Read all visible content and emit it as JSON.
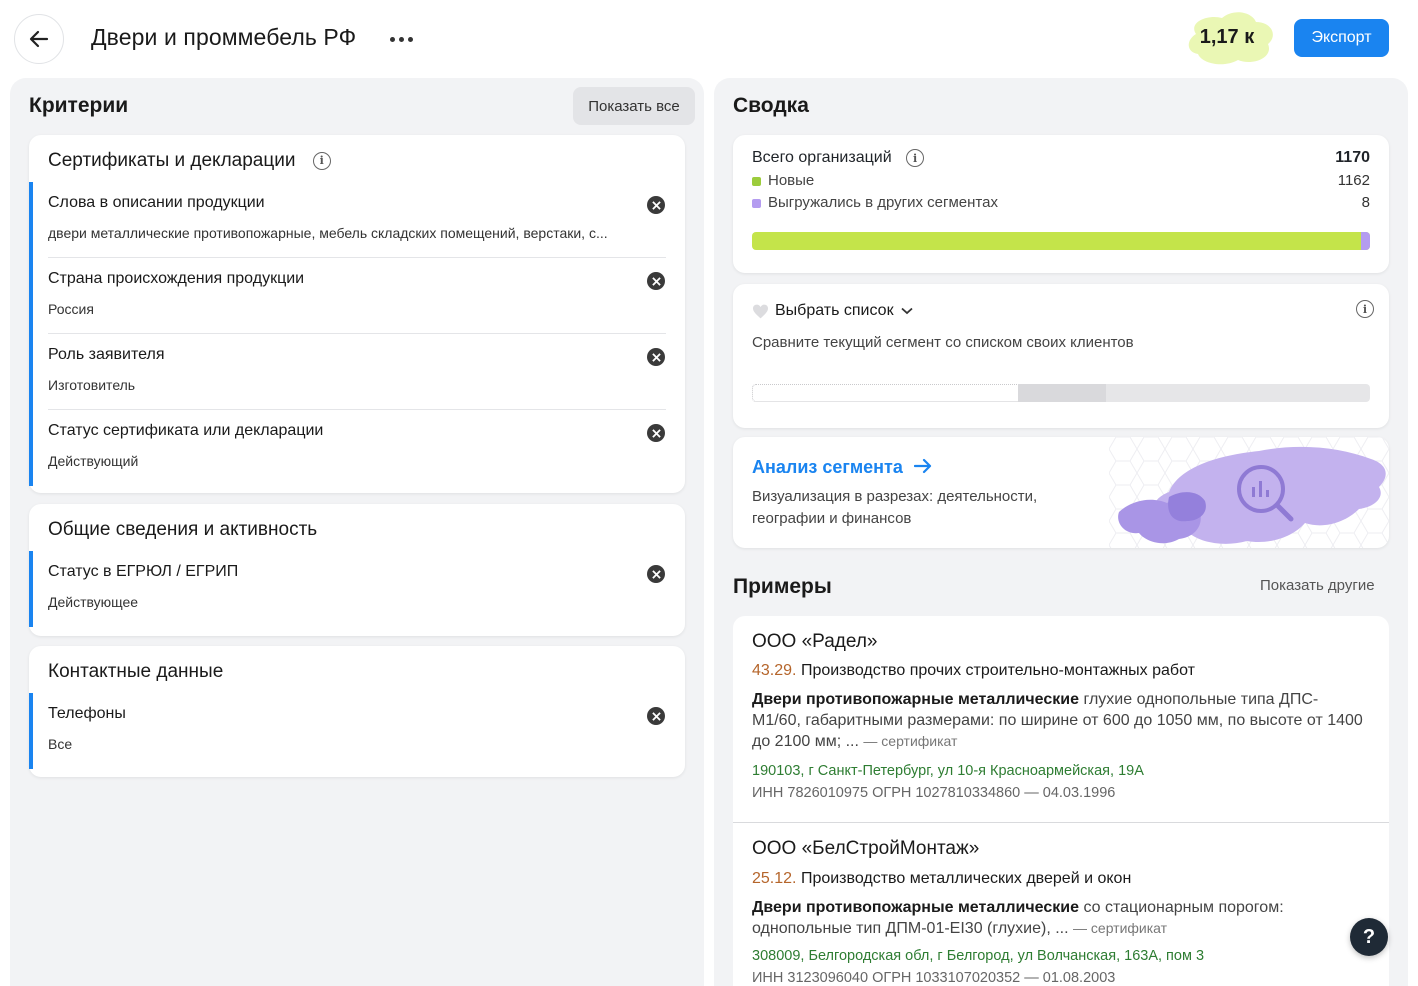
{
  "header": {
    "title": "Двери и проммебель РФ",
    "count": "1,17 к",
    "export_label": "Экспорт"
  },
  "criteria": {
    "heading": "Критерии",
    "show_all_label": "Показать все",
    "groups": [
      {
        "title": "Сертификаты и декларации",
        "items": [
          {
            "label": "Слова в описании продукции",
            "value": "двери металлические противопожарные, мебель складских помещений, верстаки, с..."
          },
          {
            "label": "Страна происхождения продукции",
            "value": "Россия"
          },
          {
            "label": "Роль заявителя",
            "value": "Изготовитель"
          },
          {
            "label": "Статус сертификата или декларации",
            "value": "Действующий"
          }
        ]
      },
      {
        "title": "Общие сведения и активность",
        "items": [
          {
            "label": "Статус в ЕГРЮЛ / ЕГРИП",
            "value": "Действующее"
          }
        ]
      },
      {
        "title": "Контактные данные",
        "items": [
          {
            "label": "Телефоны",
            "value": "Все"
          }
        ]
      }
    ]
  },
  "summary": {
    "heading": "Сводка",
    "total_label": "Всего организаций",
    "total_value": "1170",
    "new_label": "Новые",
    "new_value": "1162",
    "exported_label": "Выгружались в других сегментах",
    "exported_value": "8",
    "new_fraction": 0.9932,
    "colors": {
      "new": "#c4e44a",
      "exported": "#b49cf0",
      "accent": "#1a84f0"
    }
  },
  "compare": {
    "select_label": "Выбрать список",
    "description": "Сравните текущий сегмент со списком своих клиентов"
  },
  "analysis": {
    "link_label": "Анализ сегмента",
    "description": "Визуализация в разрезах: деятельности, географии и финансов"
  },
  "examples": {
    "heading": "Примеры",
    "show_other_label": "Показать другие",
    "items": [
      {
        "name": "ООО «Радел»",
        "okved_code": "43.29.",
        "okved_text": "Производство прочих строительно-монтажных работ",
        "desc_bold": "Двери противопожарные металлические",
        "desc_rest": " глухие однопольные типа ДПС-М1/60, габаритными размерами: по ширине от 600 до 1050 мм, по высоте от 1400 до 2100 мм; ... ",
        "desc_source": "— сертификат",
        "address": "190103, г Санкт-Петербург, ул 10-я Красноармейская, 19А",
        "ids": "ИНН 7826010975   ОГРН 1027810334860 — 04.03.1996"
      },
      {
        "name": "ООО «БелСтройМонтаж»",
        "okved_code": "25.12.",
        "okved_text": "Производство металлических дверей и окон",
        "desc_bold": "Двери противопожарные металлические",
        "desc_rest": " со стационарным порогом: однопольные тип ДПМ-01-EI30 (глухие), ... ",
        "desc_source": "— сертификат",
        "address": "308009, Белгородская обл, г Белгород, ул Волчанская, 163А, пом 3",
        "ids": "ИНН 3123096040   ОГРН 1033107020352 — 01.08.2003"
      }
    ]
  },
  "help_label": "?"
}
